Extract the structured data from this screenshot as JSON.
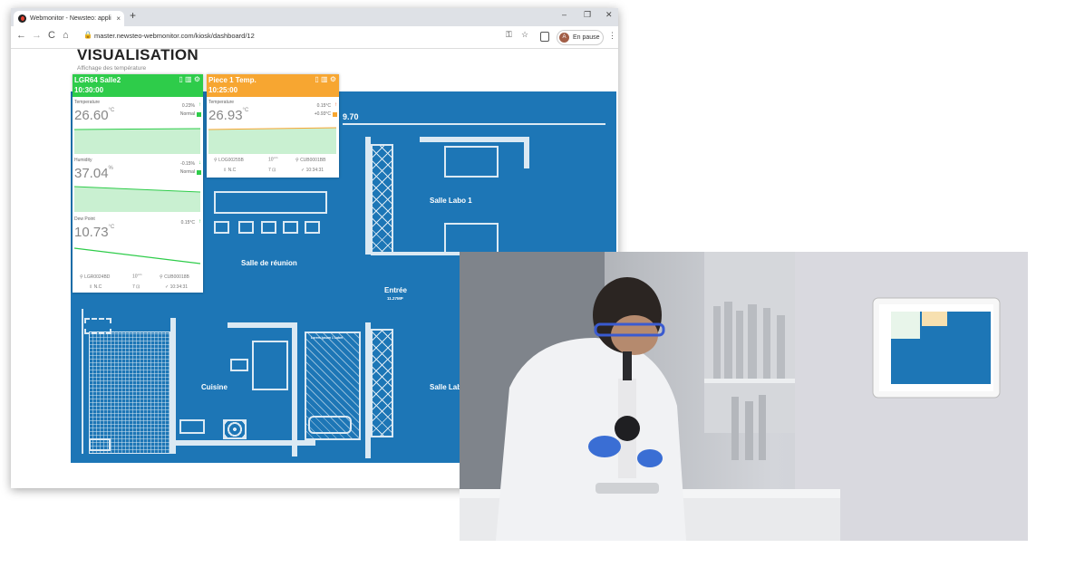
{
  "browser": {
    "tab_title": "Webmonitor - Newsteo: applicatio...",
    "tab_close": "×",
    "new_tab": "+",
    "win_min": "–",
    "win_max": "❐",
    "win_close": "✕",
    "nav_back": "←",
    "nav_forward": "→",
    "nav_reload": "C",
    "nav_home": "⌂",
    "lock": "🔒",
    "url": "master.newsteo-webmonitor.com/kiosk/dashboard/12",
    "key_icon": "⚿",
    "star_icon": "☆",
    "profile_initial": "A",
    "pause_label": "En pause",
    "menu_icon": "⋮"
  },
  "page": {
    "title": "VISUALISATION",
    "subtitle": "Affichage des température"
  },
  "plan": {
    "dimension": "9.70",
    "rooms": {
      "labo1": "Salle Labo 1",
      "reunion": "Salle de réunion",
      "entree": "Entrée",
      "entree_sub": "11.27MP",
      "cuisine": "Cuisine",
      "labo2": "Salle Labo",
      "small_note": "Lorem Ipsum 1 Label"
    }
  },
  "widget1": {
    "name": "LGR64 Salle2",
    "time": "10:30:00",
    "color": "#2ecc4a",
    "sections": [
      {
        "label": "Temperature",
        "value": "26.60",
        "unit": "°C",
        "delta": "0.23%",
        "status": "Normal",
        "arrow": "↑"
      },
      {
        "label": "Humidity",
        "value": "37.04",
        "unit": "%",
        "delta": "-0.15%",
        "status": "Normal",
        "arrow": "↓"
      },
      {
        "label": "Dew Point",
        "value": "10.73",
        "unit": "°C",
        "delta": "0.15°C",
        "status": "",
        "arrow": "↑"
      }
    ],
    "footer": {
      "logger": "LGR0024BD",
      "interval": "10",
      "interval_unit": "min",
      "cub": "CUB00018B",
      "nc": "N.C",
      "count": "7",
      "last": "10:34:31"
    }
  },
  "widget2": {
    "name": "Piece 1 Temp.",
    "time": "10:25:00",
    "color": "#f7a631",
    "sections": [
      {
        "label": "Temperature",
        "value": "26.93",
        "unit": "°C",
        "delta": "0.15°C",
        "status": "+0.93°C",
        "arrow": "↑"
      }
    ],
    "footer": {
      "logger": "LOG00255B",
      "interval": "10",
      "interval_unit": "min",
      "cub": "CUB0001BB",
      "nc": "N.C",
      "count": "7",
      "last": "10:34:31"
    }
  },
  "colors": {
    "plan_blue": "#1d76b6",
    "green": "#2ecc4a",
    "orange": "#f7a631"
  }
}
